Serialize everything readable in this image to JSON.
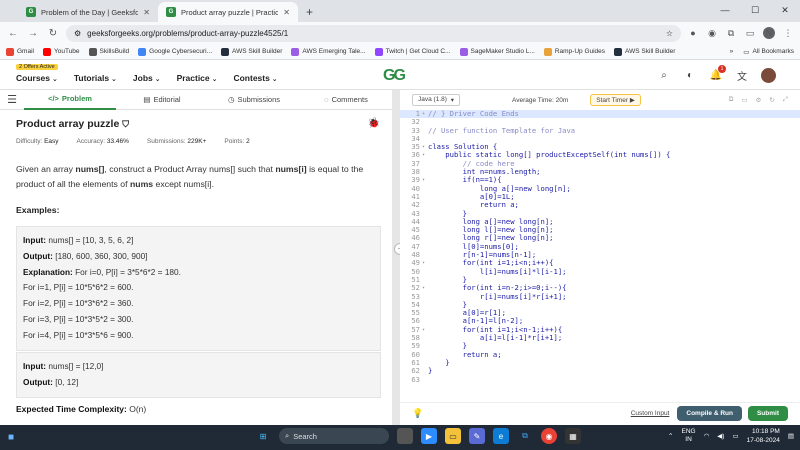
{
  "browser": {
    "tabs": [
      {
        "title": "Problem of the Day | Geeksfor",
        "active": false
      },
      {
        "title": "Product array puzzle | Practice |",
        "active": true
      }
    ],
    "url": "geeksforgeeks.org/problems/product-array-puzzle4525/1",
    "profile_letter": "N",
    "bookmarks": [
      "Gmail",
      "YouTube",
      "SkillsBuild",
      "Google Cybersecuri...",
      "AWS Skill Builder",
      "AWS Emerging Tale...",
      "Twitch | Get Cloud C...",
      "SageMaker Studio L...",
      "Ramp-Up Guides",
      "AWS Skill Builder"
    ],
    "all_bookmarks": "All Bookmarks"
  },
  "site": {
    "offer_badge": "2 Offers Active",
    "nav": [
      "Courses",
      "Tutorials",
      "Jobs",
      "Practice",
      "Contests"
    ],
    "logo": "GG",
    "notif_count": "1"
  },
  "problem": {
    "tabs": [
      "Problem",
      "Editorial",
      "Submissions",
      "Comments"
    ],
    "title": "Product array puzzle",
    "meta": {
      "difficulty_label": "Difficulty:",
      "difficulty": "Easy",
      "accuracy_label": "Accuracy:",
      "accuracy": "33.46%",
      "submissions_label": "Submissions:",
      "submissions": "229K+",
      "points_label": "Points:",
      "points": "2"
    },
    "description": [
      {
        "t": "Given an array ",
        "b": false
      },
      {
        "t": "nums[]",
        "b": true
      },
      {
        "t": ", construct a Product Array nums[] such that ",
        "b": false
      },
      {
        "t": "nums[i]",
        "b": true
      },
      {
        "t": " is equal to the product of all the elements of ",
        "b": false
      },
      {
        "t": "nums",
        "b": true
      },
      {
        "t": " except nums[i].",
        "b": false
      }
    ],
    "examples_heading": "Examples:",
    "example1": {
      "input_label": "Input:",
      "input": "nums[] = [10, 3, 5, 6, 2]",
      "output_label": "Output:",
      "output": "[180, 600, 360, 300, 900]",
      "explanation_label": "Explanation:",
      "explanation": "For i=0, P[i] = 3*5*6*2 = 180.",
      "lines": [
        "For i=1, P[i] = 10*5*6*2 = 600.",
        "For i=2, P[i] = 10*3*6*2 = 360.",
        "For i=3, P[i] = 10*3*5*2 = 300.",
        "For i=4, P[i] = 10*3*5*6 = 900."
      ]
    },
    "example2": {
      "input_label": "Input:",
      "input": "nums[] = [12,0]",
      "output_label": "Output:",
      "output": "[0, 12]"
    },
    "complexity_label": "Expected Time Complexity:",
    "complexity": "O(n)"
  },
  "editor": {
    "language": "Java (1.8)",
    "avg_time": "Average Time: 20m",
    "timer": "Start Timer",
    "lines": [
      {
        "n": "1",
        "fold": "+",
        "text": "// } Driver Code Ends",
        "hl": true
      },
      {
        "n": "32",
        "fold": "",
        "text": ""
      },
      {
        "n": "33",
        "fold": "",
        "text": "// User function Template for Java"
      },
      {
        "n": "34",
        "fold": "",
        "text": ""
      },
      {
        "n": "35",
        "fold": "▾",
        "text": "class Solution {"
      },
      {
        "n": "36",
        "fold": "▾",
        "text": "    public static long[] productExceptSelf(int nums[]) {"
      },
      {
        "n": "37",
        "fold": "",
        "text": "        // code here"
      },
      {
        "n": "38",
        "fold": "",
        "text": "        int n=nums.length;"
      },
      {
        "n": "39",
        "fold": "▾",
        "text": "        if(n==1){"
      },
      {
        "n": "40",
        "fold": "",
        "text": "            long a[]=new long[n];"
      },
      {
        "n": "41",
        "fold": "",
        "text": "            a[0]=1L;"
      },
      {
        "n": "42",
        "fold": "",
        "text": "            return a;"
      },
      {
        "n": "43",
        "fold": "",
        "text": "        }"
      },
      {
        "n": "44",
        "fold": "",
        "text": "        long a[]=new long[n];"
      },
      {
        "n": "45",
        "fold": "",
        "text": "        long l[]=new long[n];"
      },
      {
        "n": "46",
        "fold": "",
        "text": "        long r[]=new long[n];"
      },
      {
        "n": "47",
        "fold": "",
        "text": "        l[0]=nums[0];"
      },
      {
        "n": "48",
        "fold": "",
        "text": "        r[n-1]=nums[n-1];"
      },
      {
        "n": "49",
        "fold": "▾",
        "text": "        for(int i=1;i<n;i++){"
      },
      {
        "n": "50",
        "fold": "",
        "text": "            l[i]=nums[i]*l[i-1];"
      },
      {
        "n": "51",
        "fold": "",
        "text": "        }"
      },
      {
        "n": "52",
        "fold": "▾",
        "text": "        for(int i=n-2;i>=0;i--){"
      },
      {
        "n": "53",
        "fold": "",
        "text": "            r[i]=nums[i]*r[i+1];"
      },
      {
        "n": "54",
        "fold": "",
        "text": "        }"
      },
      {
        "n": "55",
        "fold": "",
        "text": "        a[0]=r[1];"
      },
      {
        "n": "56",
        "fold": "",
        "text": "        a[n-1]=l[n-2];"
      },
      {
        "n": "57",
        "fold": "▾",
        "text": "        for(int i=1;i<n-1;i++){"
      },
      {
        "n": "58",
        "fold": "",
        "text": "            a[i]=l[i-1]*r[i+1];"
      },
      {
        "n": "59",
        "fold": "",
        "text": "        }"
      },
      {
        "n": "60",
        "fold": "",
        "text": "        return a;"
      },
      {
        "n": "61",
        "fold": "",
        "text": "    }"
      },
      {
        "n": "62",
        "fold": "",
        "text": "}"
      },
      {
        "n": "63",
        "fold": "",
        "text": ""
      }
    ],
    "custom_input": "Custom Input",
    "compile_run": "Compile & Run",
    "submit": "Submit"
  },
  "taskbar": {
    "search": "Search",
    "lang_line1": "ENG",
    "lang_line2": "IN",
    "time": "10:18 PM",
    "date": "17-08-2024"
  }
}
